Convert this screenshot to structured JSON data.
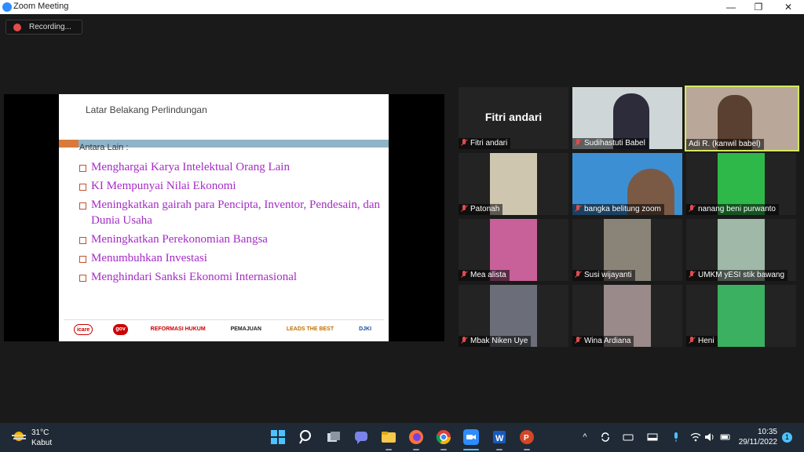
{
  "window": {
    "title": "Zoom Meeting",
    "minimize_glyph": "—",
    "restore_glyph": "❐",
    "close_glyph": "✕"
  },
  "meeting": {
    "recording_label": "Recording...",
    "recording_color": "#e34b4b",
    "active_speaker_border": "#d5e85f"
  },
  "slide": {
    "title": "Latar Belakang Perlindungan",
    "subtitle": "Antara Lain :",
    "bullet_color": "#a52bc6",
    "bullets": [
      "Menghargai Karya Intelektual Orang Lain",
      "KI Mempunyai Nilai Ekonomi",
      "Meningkatkan  gairah para Pencipta, Inventor, Pendesain, dan Dunia Usaha",
      "Meningkatkan Perekonomian Bangsa",
      "Menumbuhkan Investasi",
      "Menghindari Sanksi  Ekonomi Internasional"
    ],
    "logos": [
      "icare",
      "gov",
      "REFORMASI HUKUM",
      "PEMAJUAN",
      "LEADS THE BEST",
      "DJKI"
    ]
  },
  "participants": [
    {
      "name": "Fitri andari",
      "big_name": "Fitri andari",
      "muted": true,
      "video": false
    },
    {
      "name": "Sudihastuti Babel",
      "muted": true,
      "video": true
    },
    {
      "name": "Adi R. (kanwil babel)",
      "muted": false,
      "video": true,
      "active": true
    },
    {
      "name": "Patonah",
      "muted": true,
      "video": true
    },
    {
      "name": "bangka belitung zoom",
      "muted": true,
      "video": true
    },
    {
      "name": "nanang beni purwanto",
      "muted": true,
      "video": true
    },
    {
      "name": "Mea alista",
      "muted": true,
      "video": true
    },
    {
      "name": "Susi wijayanti",
      "muted": true,
      "video": true
    },
    {
      "name": "UMKM yESI stik bawang",
      "muted": true,
      "video": true
    },
    {
      "name": "Mbak Niken Uye",
      "muted": true,
      "video": true
    },
    {
      "name": "Wina Ardiana",
      "muted": true,
      "video": true
    },
    {
      "name": "Heni",
      "muted": true,
      "video": true
    }
  ],
  "taskbar": {
    "weather_temp": "31°C",
    "weather_condition": "Kabut",
    "time": "10:35",
    "date": "29/11/2022",
    "notification_count": "1",
    "apps": [
      "windows-start",
      "search",
      "task-view",
      "teams-chat",
      "file-explorer",
      "firefox",
      "chrome",
      "zoom",
      "word",
      "powerpoint"
    ],
    "tray_glyphs": {
      "chevron": "^",
      "mic": "●",
      "battery": "▭"
    }
  }
}
